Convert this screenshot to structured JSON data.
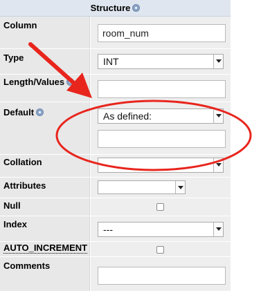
{
  "header": {
    "title": "Structure",
    "info_icon": "info-icon"
  },
  "rows": {
    "column": {
      "label": "Column",
      "value": "room_num"
    },
    "type": {
      "label": "Type",
      "selected": "INT"
    },
    "length_values": {
      "label": "Length/Values",
      "value": "",
      "info_icon": "info-icon"
    },
    "default": {
      "label": "Default",
      "selected": "As defined:",
      "value": "",
      "info_icon": "info-icon"
    },
    "collation": {
      "label": "Collation",
      "selected": ""
    },
    "attributes": {
      "label": "Attributes",
      "selected": ""
    },
    "null": {
      "label": "Null",
      "checked": false
    },
    "index": {
      "label": "Index",
      "selected": "---"
    },
    "auto_increment": {
      "label": "AUTO_INCREMENT",
      "checked": false
    },
    "comments": {
      "label": "Comments",
      "value": ""
    }
  },
  "annotation": {
    "arrow_color": "#e8251d",
    "ellipse_color": "#e8251d"
  },
  "colors": {
    "header_bg": "#dfe6ef",
    "row_bg": "#eeeeee",
    "label_bg": "#e8e8e8"
  }
}
